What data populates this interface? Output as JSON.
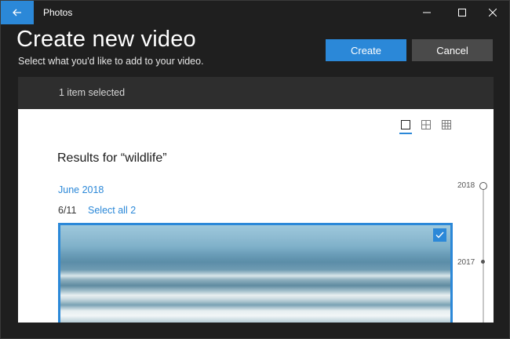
{
  "window": {
    "app_title": "Photos"
  },
  "header": {
    "title": "Create new video",
    "subtitle": "Select what you'd like to add to your video.",
    "create_label": "Create",
    "cancel_label": "Cancel"
  },
  "selection_bar": {
    "text": "1 item selected"
  },
  "content": {
    "results_heading": "Results for “wildlife”",
    "group_label": "June 2018",
    "day_label": "6/11",
    "select_all_label": "Select all 2",
    "item_selected": true
  },
  "timeline": {
    "years": [
      "2018",
      "2017"
    ]
  },
  "colors": {
    "accent": "#2b88d8",
    "chrome": "#1f1f1f",
    "cancel": "#4a4a4a",
    "panel": "#ffffff"
  },
  "icons": {
    "back": "back-arrow-icon",
    "minimize": "minimize-icon",
    "maximize": "maximize-icon",
    "close": "close-icon",
    "view_large": "single-view-icon",
    "view_medium": "medium-grid-icon",
    "view_small": "small-grid-icon",
    "check": "checkmark-icon"
  }
}
